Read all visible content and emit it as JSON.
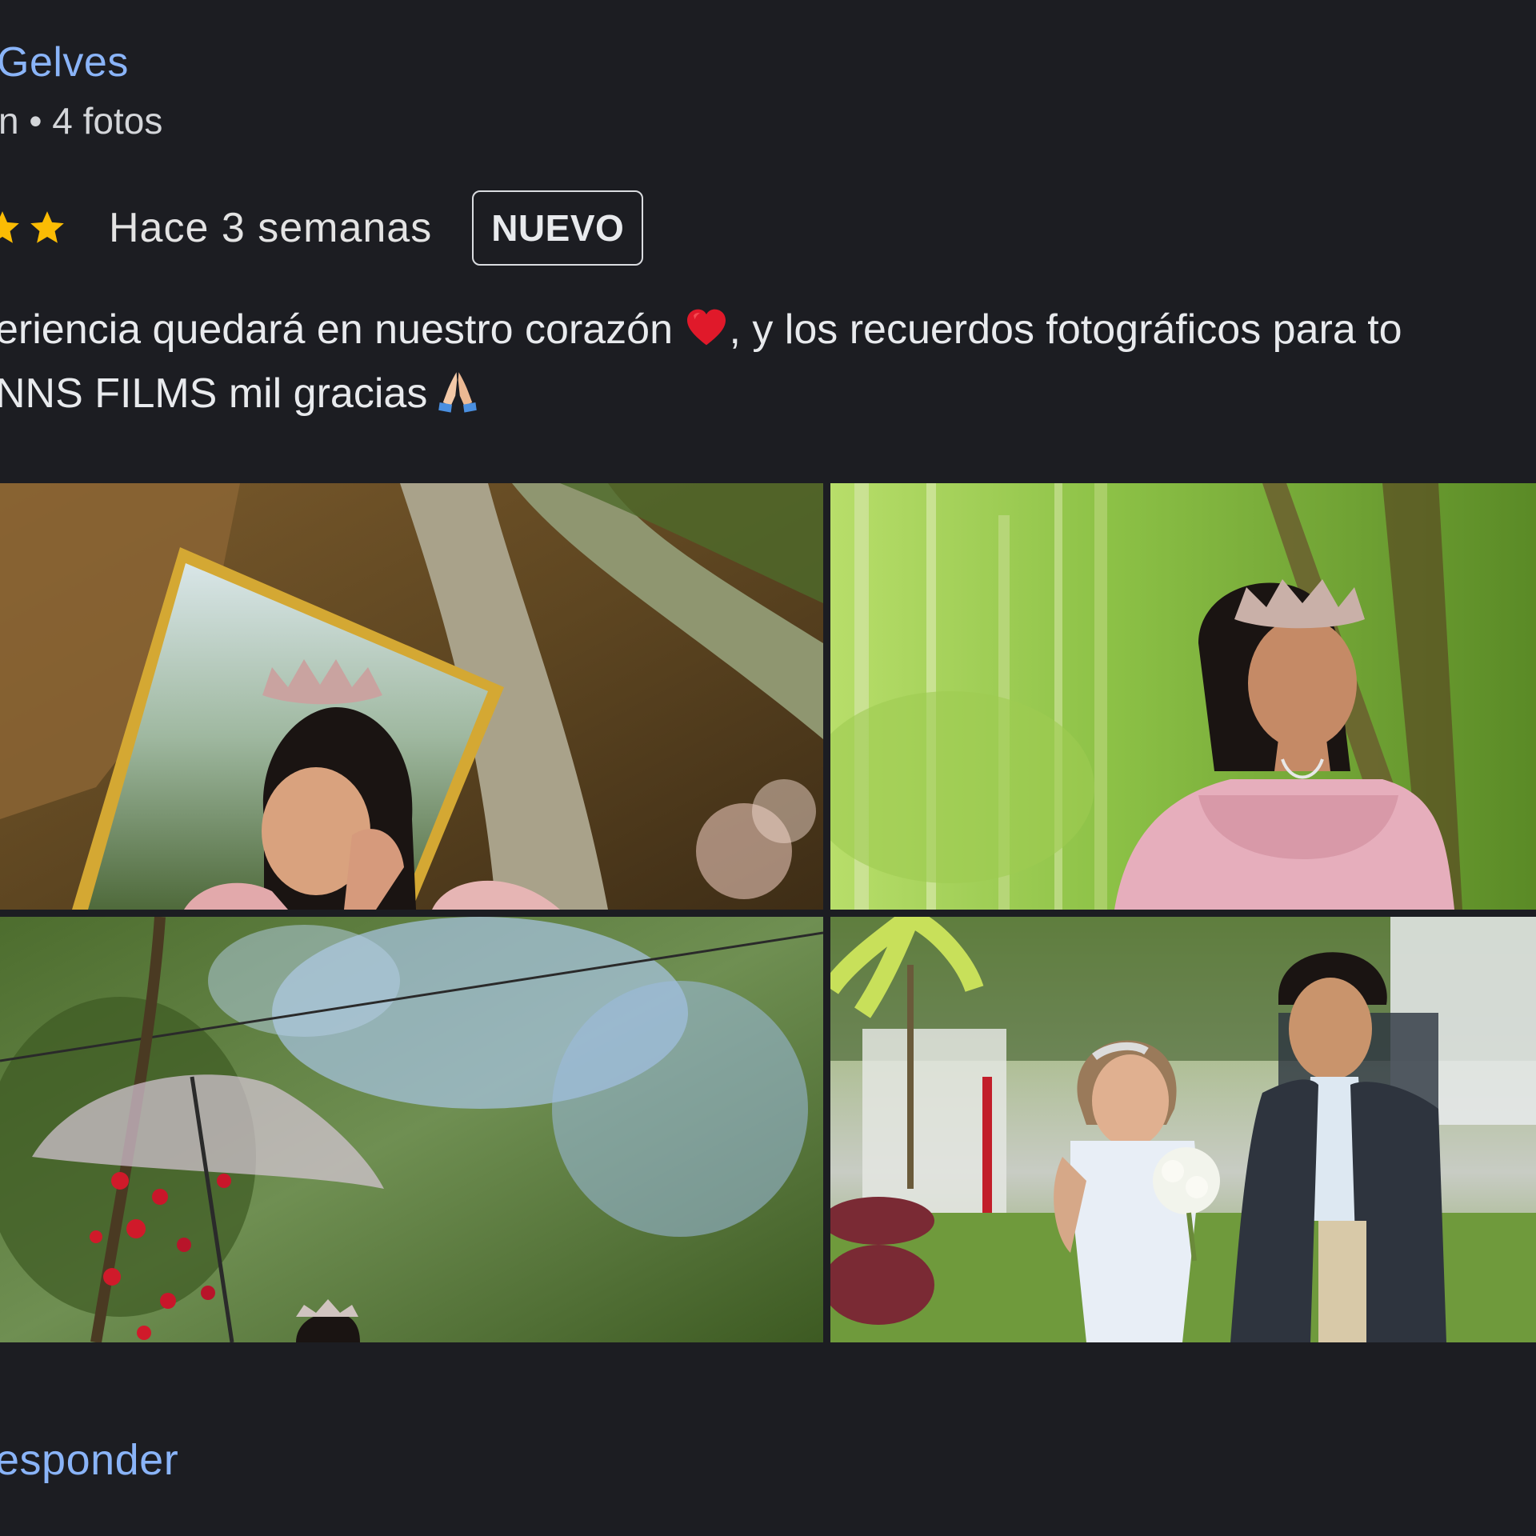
{
  "review": {
    "author_name": "Gelves",
    "author_meta": "n • 4 fotos",
    "rating_stars_visible": 2,
    "time": "Hace 3 semanas",
    "badge": "NUEVO",
    "text_line1_a": "eriencia quedará en nuestro corazón",
    "text_line1_b": ", y los recuerdos fotográficos para to",
    "text_line2": "NNS FILMS mil gracias",
    "reply_label": "esponder"
  },
  "photos_count": 4,
  "colors": {
    "background": "#1c1d22",
    "link": "#8ab4f8",
    "star": "#fbbc04",
    "text": "#e8eaed"
  },
  "icons": {
    "star": "star-icon",
    "heart": "red-heart-emoji",
    "pray": "folded-hands-emoji"
  }
}
